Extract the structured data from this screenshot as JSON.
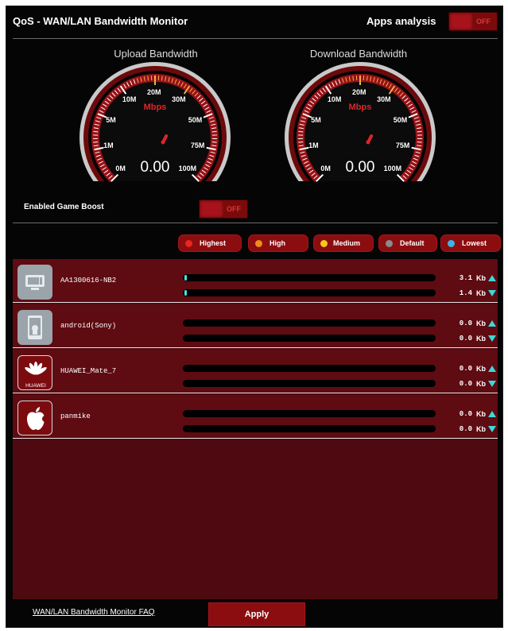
{
  "header": {
    "title": "QoS - WAN/LAN Bandwidth Monitor",
    "apps_analysis_label": "Apps analysis",
    "apps_analysis_toggle": "OFF"
  },
  "gauges": {
    "upload": {
      "title": "Upload Bandwidth",
      "unit": "Mbps",
      "reading": "0.00",
      "ticks": [
        "0M",
        "1M",
        "5M",
        "10M",
        "20M",
        "30M",
        "50M",
        "75M",
        "100M"
      ]
    },
    "download": {
      "title": "Download Bandwidth",
      "unit": "Mbps",
      "reading": "0.00",
      "ticks": [
        "0M",
        "1M",
        "5M",
        "10M",
        "20M",
        "30M",
        "50M",
        "75M",
        "100M"
      ]
    }
  },
  "game_boost": {
    "label": "Enabled Game Boost",
    "toggle": "OFF"
  },
  "legend": [
    {
      "label": "Highest",
      "color": "#e8271f"
    },
    {
      "label": "High",
      "color": "#f08c1c"
    },
    {
      "label": "Medium",
      "color": "#f2c81c"
    },
    {
      "label": "Default",
      "color": "#8a8a8a"
    },
    {
      "label": "Lowest",
      "color": "#3ab4e6"
    }
  ],
  "devices": [
    {
      "name": "AA1300616-NB2",
      "icon": "desktop-icon",
      "upload": "3.1",
      "download": "1.4",
      "upload_level": 0.01,
      "download_level": 0.01,
      "unit": "Kb"
    },
    {
      "name": "android(Sony)",
      "icon": "android-phone-icon",
      "upload": "0.0",
      "download": "0.0",
      "upload_level": 0,
      "download_level": 0,
      "unit": "Kb"
    },
    {
      "name": "HUAWEI_Mate_7",
      "icon": "huawei-logo-icon",
      "icon_text": "HUAWEI",
      "upload": "0.0",
      "download": "0.0",
      "upload_level": 0,
      "download_level": 0,
      "unit": "Kb"
    },
    {
      "name": "panmike",
      "icon": "apple-logo-icon",
      "upload": "0.0",
      "download": "0.0",
      "upload_level": 0,
      "download_level": 0,
      "unit": "Kb"
    }
  ],
  "footer": {
    "faq_link": "WAN/LAN Bandwidth Monitor FAQ",
    "apply_button": "Apply"
  },
  "colors": {
    "background": "#050505",
    "accent": "#8b0d10",
    "panel": "#4e0a10",
    "rate_arrow": "#3cd8d8"
  }
}
